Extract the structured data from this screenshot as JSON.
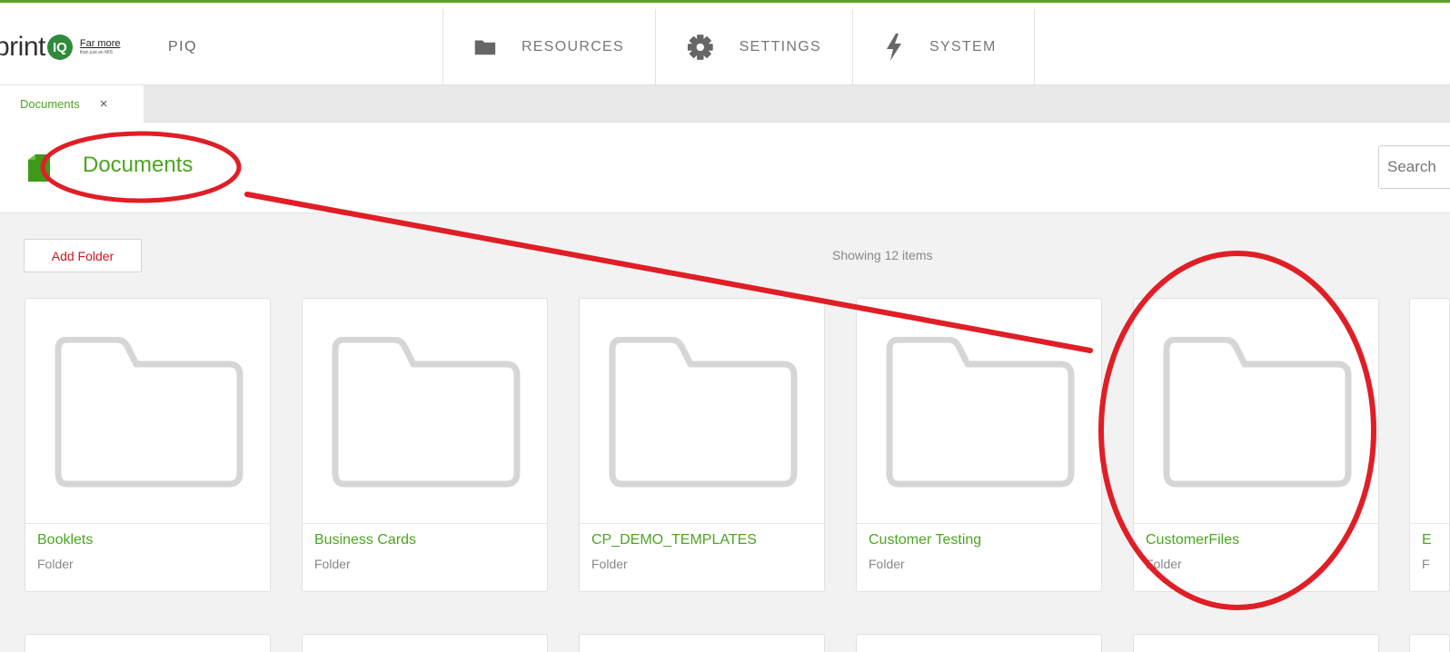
{
  "header": {
    "logo_text": "print",
    "logo_badge": "IQ",
    "logo_tag": "Far more",
    "logo_tag_small": "than just an MIS",
    "app_name": "PIQ",
    "nav": [
      {
        "label": "RESOURCES",
        "icon": "folder-icon"
      },
      {
        "label": "SETTINGS",
        "icon": "gear-icon"
      },
      {
        "label": "SYSTEM",
        "icon": "lightning-icon"
      }
    ]
  },
  "tabs": [
    {
      "label": "Documents",
      "close": "×"
    }
  ],
  "page": {
    "title": "Documents",
    "search_placeholder": "Search"
  },
  "toolbar": {
    "add_folder_label": "Add Folder",
    "count_text": "Showing 12 items"
  },
  "folders": [
    {
      "name": "Booklets",
      "type": "Folder"
    },
    {
      "name": "Business Cards",
      "type": "Folder"
    },
    {
      "name": "CP_DEMO_TEMPLATES",
      "type": "Folder"
    },
    {
      "name": "Customer Testing",
      "type": "Folder"
    },
    {
      "name": "CustomerFiles",
      "type": "Folder"
    },
    {
      "name": "E",
      "type": "F"
    }
  ],
  "colors": {
    "accent_green": "#4ca51f",
    "annotation_red": "#e01e26",
    "add_button_text": "#d0161f"
  }
}
